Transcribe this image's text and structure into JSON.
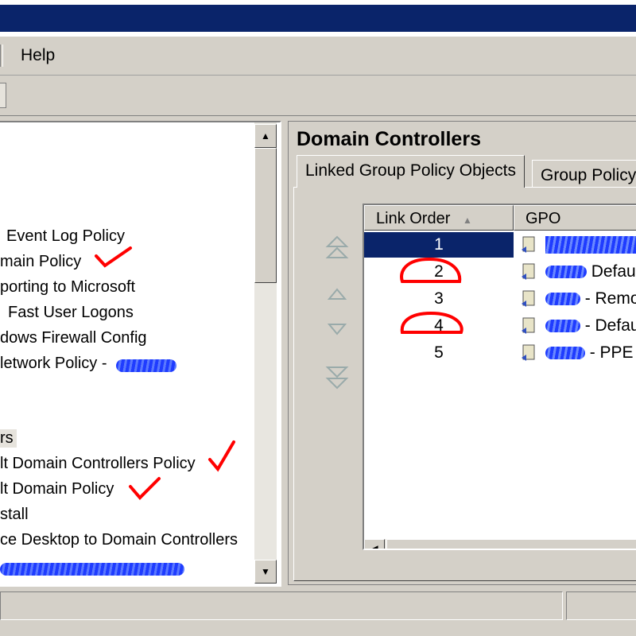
{
  "menu": {
    "help_label": "Help"
  },
  "tree": {
    "items": [
      "Event Log Policy",
      "main Policy",
      "porting to Microsoft",
      "Fast User Logons",
      "dows Firewall Config",
      "letwork Policy -",
      "rs",
      "lt Domain Controllers Policy",
      "lt Domain Policy",
      "stall",
      "ce Desktop to Domain Controllers"
    ]
  },
  "right": {
    "title": "Domain Controllers",
    "tabs": [
      "Linked Group Policy Objects",
      "Group Policy"
    ],
    "columns": {
      "order": "Link Order",
      "gpo": "GPO"
    },
    "rows": [
      {
        "order": "1",
        "gpo": "",
        "selected": true
      },
      {
        "order": "2",
        "gpo": "Defau",
        "selected": false
      },
      {
        "order": "3",
        "gpo": "- Remo",
        "selected": false
      },
      {
        "order": "4",
        "gpo": "- Defau",
        "selected": false
      },
      {
        "order": "5",
        "gpo": "- PPE i",
        "selected": false
      }
    ]
  },
  "colors": {
    "titlebar": "#0a246a",
    "selection": "#0a246a",
    "annotation": "#ff0000",
    "redaction": "#1f3cff"
  },
  "icons": [
    "move-top-icon",
    "move-up-icon",
    "move-down-icon",
    "move-bottom-icon",
    "gpo-link-icon",
    "checkmark-annotation-icon"
  ]
}
